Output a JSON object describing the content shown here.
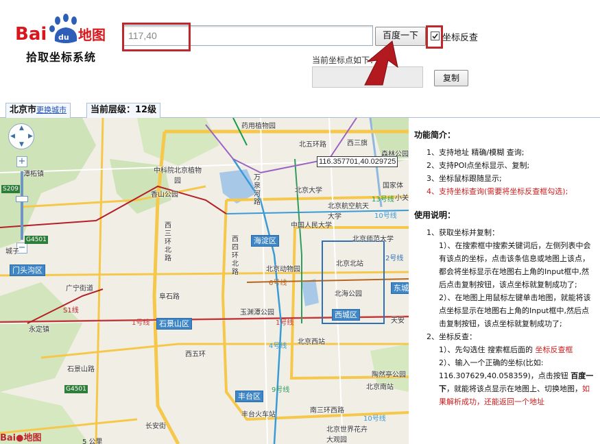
{
  "header": {
    "logo_brand": "Baidu地图",
    "logo_subtitle": "拾取坐标系统",
    "search_value": "117,40",
    "search_button": "百度一下",
    "reverse_label": "坐标反查",
    "coord_label": "当前坐标点如下：",
    "copy_button": "复制"
  },
  "tabs": {
    "city": "北京市",
    "change_city": "更换城市",
    "level": "当前层级：12级"
  },
  "map": {
    "cursor_coord": "116.357701,40.029725",
    "districts": [
      "海淀区",
      "门头沟区",
      "石景山区",
      "西城区",
      "东城",
      "丰台区"
    ],
    "labels": [
      "药用植物园",
      "北五环路",
      "西三旗",
      "森林公园",
      "中科院北京植物园",
      "香山公园",
      "北京大学",
      "国家体",
      "小关",
      "北京航空航天大学",
      "中国人民大学",
      "北京师范大学",
      "北京北站",
      "北京动物园",
      "北海公园",
      "玉渊潭公园",
      "北京西站",
      "天安",
      "陶然亭公园",
      "北京南站",
      "丰台火车站",
      "北京世界花卉大观园",
      "永定镇",
      "广宁街道",
      "阜石路",
      "长安街",
      "石景山路",
      "西四环北路",
      "西三环北路",
      "万泉河路",
      "城子",
      "潭柘镇",
      "西五环",
      "南三环西路"
    ],
    "lines": [
      "1号线",
      "4号线",
      "6号线",
      "10号线",
      "2号线",
      "13号线",
      "9号线",
      "S1线"
    ],
    "roads": [
      "S209",
      "G4501",
      "G4501"
    ],
    "scale": "5 公里"
  },
  "sidebar": {
    "intro_title": "功能简介：",
    "intro_items": [
      "1、支持地址 精确/模糊 查询;",
      "2、支持POI点坐标显示、复制;",
      "3、坐标鼠标跟随显示;",
      "4、支持坐标查询(需要将坐标反查框勾选);"
    ],
    "usage_title": "使用说明：",
    "usage_1": "1、获取坐标并复制：",
    "usage_1_1": "1）、在搜索框中搜索关键词后，左侧列表中会有该点的坐标，点击该条信息或地图上该点，都会将坐标显示在地图右上角的Input框中,然后点击复制按钮，该点坐标就复制成功了;",
    "usage_1_2": "2）、在地图上用鼠标左键单击地图，就能将该点坐标显示在地图右上角的Input框中,然后点击复制按钮，该点坐标就复制成功了;",
    "usage_2": "2、坐标反查：",
    "usage_2_1a": "1）、先勾选住 搜索框后面的 ",
    "usage_2_1b": "坐标反查框",
    "usage_2_2a": "2）、输入一个正确的坐标(比如: 116.307629,40.058359)，点击按钮 ",
    "usage_2_2b": "百度一下",
    "usage_2_2c": "，就能将该点显示在地图上、切换地图，",
    "usage_2_2d": "如果解析成功，还能返回一个地址"
  }
}
